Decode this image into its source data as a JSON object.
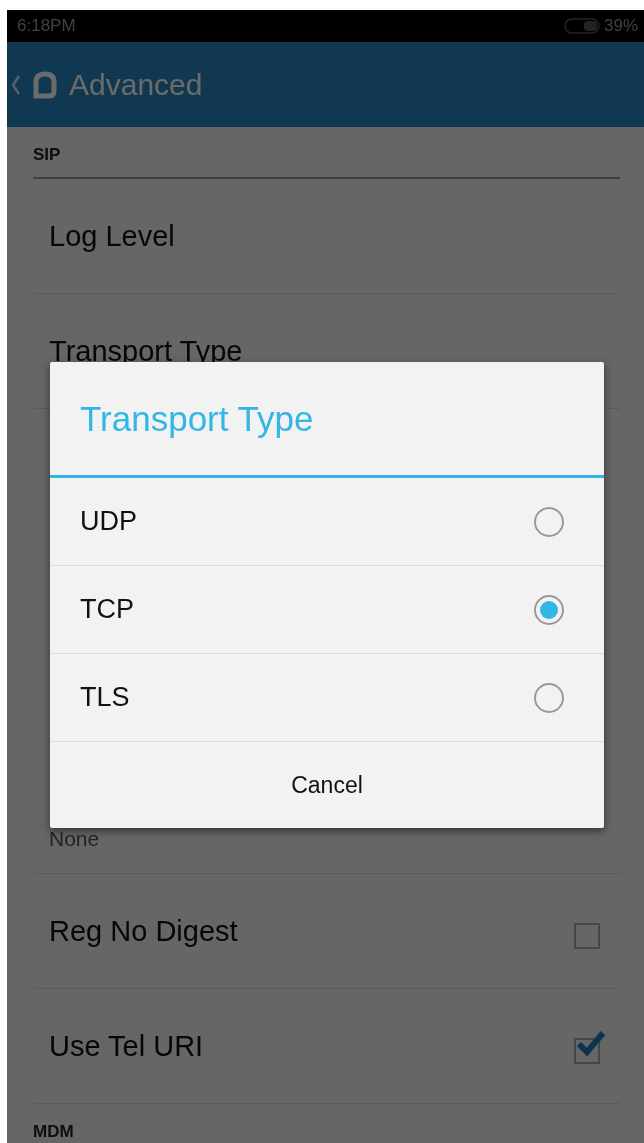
{
  "status_bar": {
    "time": "6:18PM",
    "battery": "39%"
  },
  "header": {
    "title": "Advanced"
  },
  "sections": [
    {
      "title": "SIP",
      "items": [
        {
          "kind": "plain",
          "title": "Log Level"
        },
        {
          "kind": "plain",
          "title": "Transport Type"
        },
        {
          "kind": "summary",
          "summary": "None"
        },
        {
          "kind": "checkbox",
          "title": "Reg No Digest",
          "checked": false
        },
        {
          "kind": "checkbox",
          "title": "Use Tel URI",
          "checked": true
        }
      ]
    },
    {
      "title": "MDM"
    }
  ],
  "dialog": {
    "title": "Transport Type",
    "options": [
      {
        "label": "UDP",
        "selected": false
      },
      {
        "label": "TCP",
        "selected": true
      },
      {
        "label": "TLS",
        "selected": false
      }
    ],
    "cancel": "Cancel"
  }
}
